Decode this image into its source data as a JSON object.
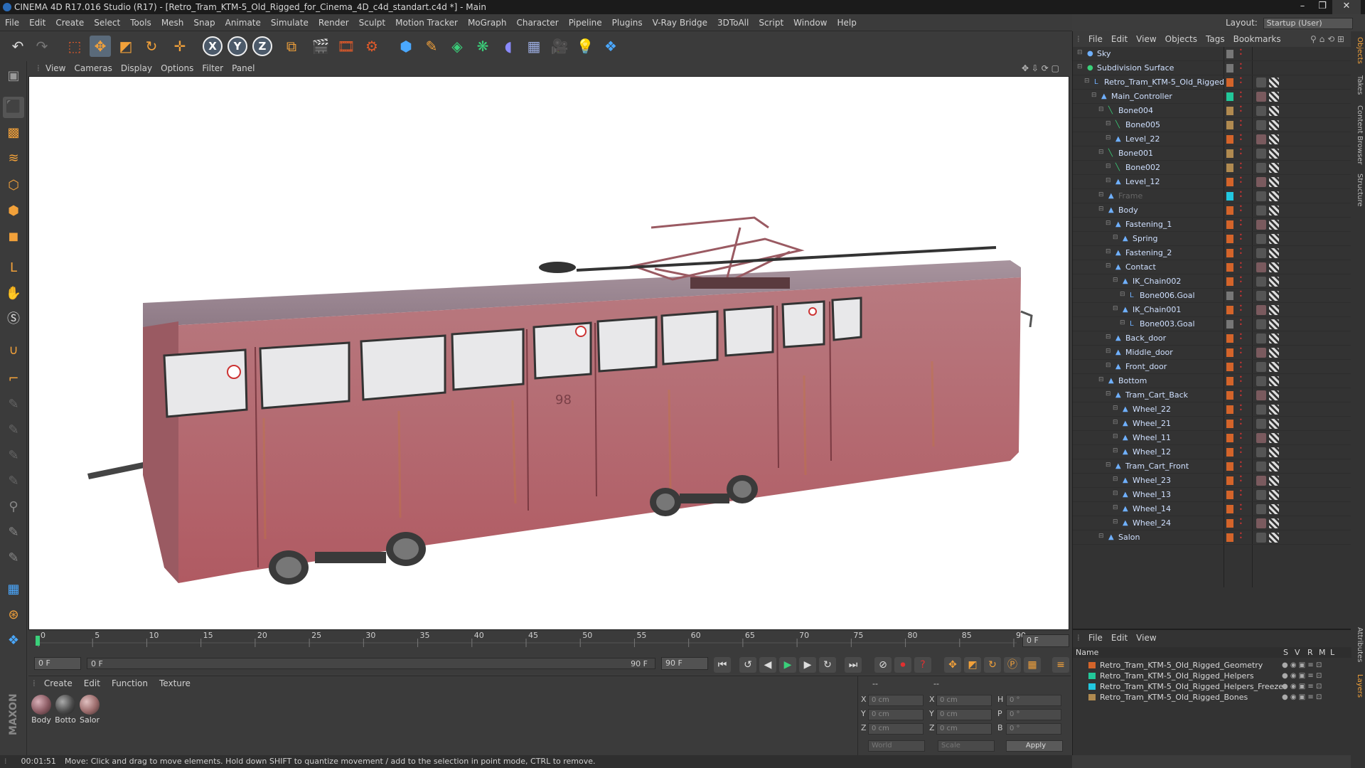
{
  "window": {
    "title": "CINEMA 4D R17.016 Studio (R17) - [Retro_Tram_KTM-5_Old_Rigged_for_Cinema_4D_c4d_standart.c4d *] - Main"
  },
  "menubar": [
    "File",
    "Edit",
    "Create",
    "Select",
    "Tools",
    "Mesh",
    "Snap",
    "Animate",
    "Simulate",
    "Render",
    "Sculpt",
    "Motion Tracker",
    "MoGraph",
    "Character",
    "Pipeline",
    "Plugins",
    "V-Ray Bridge",
    "3DToAll",
    "Script",
    "Window",
    "Help"
  ],
  "layout": {
    "label": "Layout:",
    "value": "Startup (User)"
  },
  "toolbar": {
    "axis_x": "X",
    "axis_y": "Y",
    "axis_z": "Z"
  },
  "viewport_menu": [
    "View",
    "Cameras",
    "Display",
    "Options",
    "Filter",
    "Panel"
  ],
  "viewport": {
    "tram_number": "98"
  },
  "timeline": {
    "ticks": [
      "0",
      "5",
      "10",
      "15",
      "20",
      "25",
      "30",
      "35",
      "40",
      "45",
      "50",
      "55",
      "60",
      "65",
      "70",
      "75",
      "80",
      "85",
      "90"
    ],
    "end_frame_display": "0 F"
  },
  "transport": {
    "current_frame": "0 F",
    "range_start": "0 F",
    "range_end": "90 F",
    "max_frame": "90 F"
  },
  "material_menu": [
    "Create",
    "Edit",
    "Function",
    "Texture"
  ],
  "materials": [
    {
      "label": "Body",
      "color": "#8a5a62"
    },
    {
      "label": "Botto",
      "color": "#4a4a4a"
    },
    {
      "label": "Salor",
      "color": "#9a6a6a"
    }
  ],
  "coords": {
    "header_left": "--",
    "header_right": "--",
    "x_pos": "0 cm",
    "y_pos": "0 cm",
    "z_pos": "0 cm",
    "x_size": "0 cm",
    "y_size": "0 cm",
    "z_size": "0 cm",
    "h": "0 °",
    "p": "0 °",
    "b": "0 °",
    "space": "World",
    "mode": "Scale",
    "apply": "Apply",
    "labels": {
      "x": "X",
      "y": "Y",
      "z": "Z",
      "h": "H",
      "p": "P",
      "b": "B"
    }
  },
  "status": {
    "time": "00:01:51",
    "message": "Move: Click and drag to move elements. Hold down SHIFT to quantize movement / add to the selection in point mode, CTRL to remove."
  },
  "object_menu": [
    "File",
    "Edit",
    "View",
    "Objects",
    "Tags",
    "Bookmarks"
  ],
  "objects": [
    {
      "name": "Sky",
      "depth": 0,
      "color": "#777777",
      "icon": "sky-icon"
    },
    {
      "name": "Subdivision Surface",
      "depth": 0,
      "color": "#777777",
      "icon": "subdivision-icon"
    },
    {
      "name": "Retro_Tram_KTM-5_Old_Rigged",
      "depth": 1,
      "color": "#d4642a",
      "icon": "null-icon"
    },
    {
      "name": "Main_Controller",
      "depth": 2,
      "color": "#22c89a",
      "icon": "joint-icon"
    },
    {
      "name": "Bone004",
      "depth": 3,
      "color": "#b08a50",
      "icon": "bone-icon"
    },
    {
      "name": "Bone005",
      "depth": 4,
      "color": "#b08a50",
      "icon": "bone-icon"
    },
    {
      "name": "Level_22",
      "depth": 4,
      "color": "#d4642a",
      "icon": "joint-icon"
    },
    {
      "name": "Bone001",
      "depth": 3,
      "color": "#b08a50",
      "icon": "bone-icon"
    },
    {
      "name": "Bone002",
      "depth": 4,
      "color": "#b08a50",
      "icon": "bone-icon"
    },
    {
      "name": "Level_12",
      "depth": 4,
      "color": "#d4642a",
      "icon": "joint-icon"
    },
    {
      "name": "Frame",
      "depth": 3,
      "color": "#22c8e0",
      "icon": "joint-icon"
    },
    {
      "name": "Body",
      "depth": 3,
      "color": "#d4642a",
      "icon": "joint-icon"
    },
    {
      "name": "Fastening_1",
      "depth": 4,
      "color": "#d4642a",
      "icon": "joint-icon"
    },
    {
      "name": "Spring",
      "depth": 5,
      "color": "#d4642a",
      "icon": "joint-icon"
    },
    {
      "name": "Fastening_2",
      "depth": 4,
      "color": "#d4642a",
      "icon": "joint-icon"
    },
    {
      "name": "Contact",
      "depth": 4,
      "color": "#d4642a",
      "icon": "joint-icon"
    },
    {
      "name": "IK_Chain002",
      "depth": 5,
      "color": "#d4642a",
      "icon": "ik-icon"
    },
    {
      "name": "Bone006.Goal",
      "depth": 6,
      "color": "#777777",
      "icon": "null-icon"
    },
    {
      "name": "IK_Chain001",
      "depth": 5,
      "color": "#d4642a",
      "icon": "ik-icon"
    },
    {
      "name": "Bone003.Goal",
      "depth": 6,
      "color": "#777777",
      "icon": "null-icon"
    },
    {
      "name": "Back_door",
      "depth": 4,
      "color": "#d4642a",
      "icon": "joint-icon"
    },
    {
      "name": "Middle_door",
      "depth": 4,
      "color": "#d4642a",
      "icon": "joint-icon"
    },
    {
      "name": "Front_door",
      "depth": 4,
      "color": "#d4642a",
      "icon": "joint-icon"
    },
    {
      "name": "Bottom",
      "depth": 3,
      "color": "#d4642a",
      "icon": "joint-icon"
    },
    {
      "name": "Tram_Cart_Back",
      "depth": 4,
      "color": "#d4642a",
      "icon": "joint-icon"
    },
    {
      "name": "Wheel_22",
      "depth": 5,
      "color": "#d4642a",
      "icon": "joint-icon"
    },
    {
      "name": "Wheel_21",
      "depth": 5,
      "color": "#d4642a",
      "icon": "joint-icon"
    },
    {
      "name": "Wheel_11",
      "depth": 5,
      "color": "#d4642a",
      "icon": "joint-icon"
    },
    {
      "name": "Wheel_12",
      "depth": 5,
      "color": "#d4642a",
      "icon": "joint-icon"
    },
    {
      "name": "Tram_Cart_Front",
      "depth": 4,
      "color": "#d4642a",
      "icon": "joint-icon"
    },
    {
      "name": "Wheel_23",
      "depth": 5,
      "color": "#d4642a",
      "icon": "joint-icon"
    },
    {
      "name": "Wheel_13",
      "depth": 5,
      "color": "#d4642a",
      "icon": "joint-icon"
    },
    {
      "name": "Wheel_14",
      "depth": 5,
      "color": "#d4642a",
      "icon": "joint-icon"
    },
    {
      "name": "Wheel_24",
      "depth": 5,
      "color": "#d4642a",
      "icon": "joint-icon"
    },
    {
      "name": "Salon",
      "depth": 3,
      "color": "#d4642a",
      "icon": "joint-icon"
    }
  ],
  "layer_menu": [
    "File",
    "Edit",
    "View"
  ],
  "layer_headers": {
    "name": "Name",
    "s": "S",
    "v": "V",
    "r": "R",
    "m": "M",
    "l": "L"
  },
  "layers": [
    {
      "name": "Retro_Tram_KTM-5_Old_Rigged_Geometry",
      "color": "#d4642a"
    },
    {
      "name": "Retro_Tram_KTM-5_Old_Rigged_Helpers",
      "color": "#22c89a"
    },
    {
      "name": "Retro_Tram_KTM-5_Old_Rigged_Helpers_Freeze",
      "color": "#22c8e0"
    },
    {
      "name": "Retro_Tram_KTM-5_Old_Rigged_Bones",
      "color": "#b08a50"
    }
  ],
  "side_tabs": [
    "Objects",
    "Takes",
    "Content Browser",
    "Structure",
    "Attributes",
    "Layers"
  ]
}
